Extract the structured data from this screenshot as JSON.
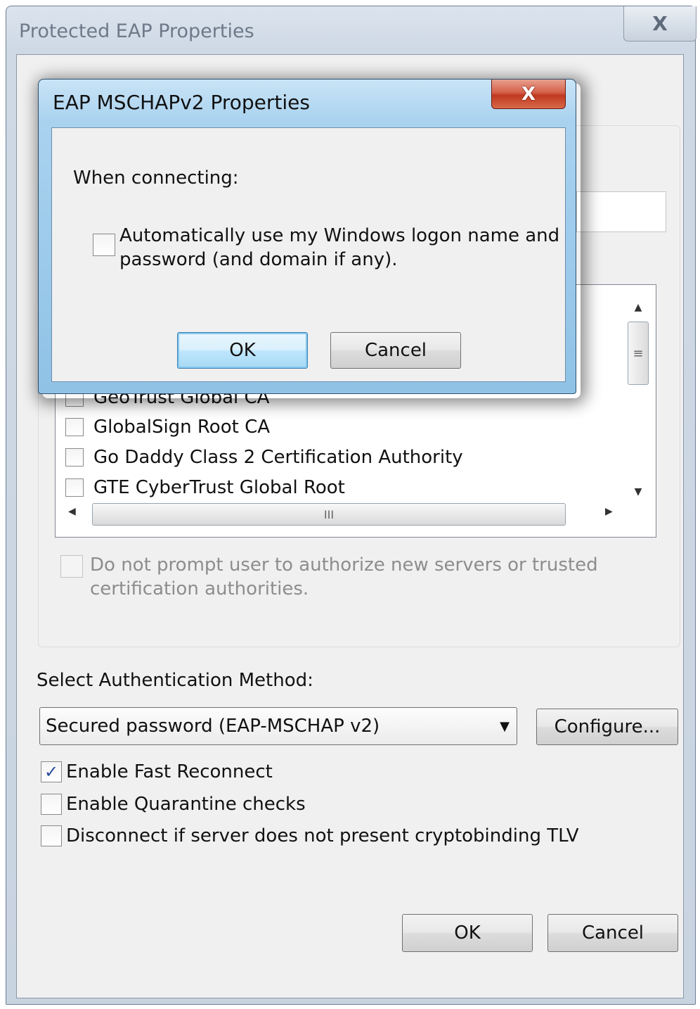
{
  "outer_dialog": {
    "title": "Protected EAP Properties",
    "close_glyph": "X",
    "certificate_list": {
      "items": [
        {
          "label": "GeoTrust Global CA",
          "checked": false
        },
        {
          "label": "GlobalSign Root CA",
          "checked": false
        },
        {
          "label": "Go Daddy Class 2 Certification Authority",
          "checked": false
        },
        {
          "label": "GTE CyberTrust Global Root",
          "checked": false
        }
      ],
      "vscroll_grip": "≡",
      "hscroll_grip": "III"
    },
    "do_not_prompt": {
      "label_line1": "Do not prompt user to authorize new servers or trusted",
      "label_line2": "certification authorities.",
      "checked": false,
      "enabled": false
    },
    "auth_method_label": "Select Authentication Method:",
    "auth_method_value": "Secured password (EAP-MSCHAP v2)",
    "configure_button": "Configure...",
    "options": [
      {
        "label": "Enable Fast Reconnect",
        "checked": true
      },
      {
        "label": "Enable Quarantine checks",
        "checked": false
      },
      {
        "label": "Disconnect if server does not present cryptobinding TLV",
        "checked": false
      }
    ],
    "ok_button": "OK",
    "cancel_button": "Cancel"
  },
  "inner_dialog": {
    "title": "EAP MSCHAPv2 Properties",
    "close_glyph": "X",
    "when_connecting_label": "When connecting:",
    "auto_logon": {
      "label_line1": "Automatically use my Windows logon name and",
      "label_line2": "password (and domain if any).",
      "checked": false
    },
    "ok_button": "OK",
    "cancel_button": "Cancel"
  }
}
